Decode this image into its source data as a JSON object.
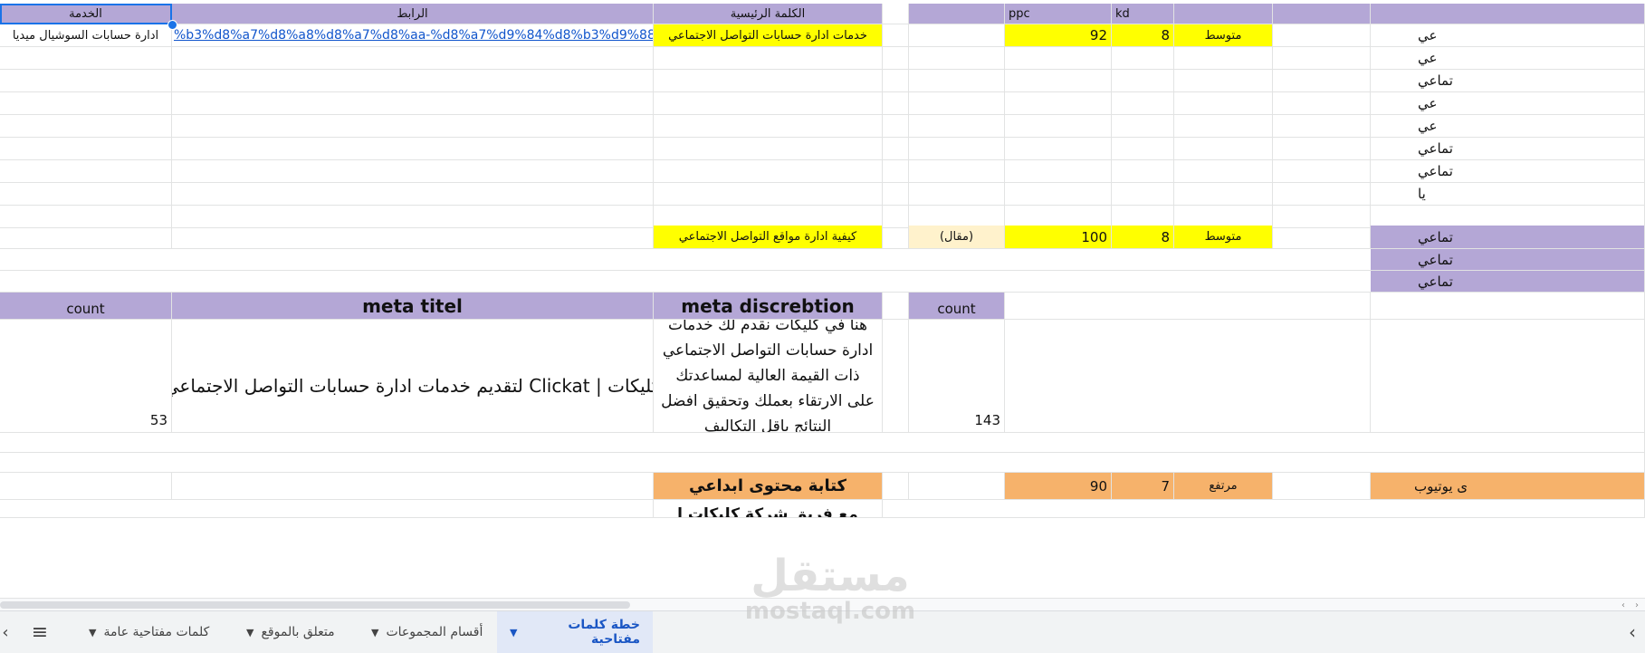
{
  "sheet": {
    "headers": {
      "service": "الخدمة",
      "link": "الرابط",
      "main_keyword": "الكلمة الرئيسية",
      "ppc": "ppc",
      "kd": "kd"
    },
    "row1": {
      "service": "ادارة حسابات السوشيال ميديا",
      "link": "%b3%d8%a7%d8%a8%d8%a7%d8%aa-%d8%a7%d9%84%d8%b3%d9%88%d8%",
      "keyword": "خدمات ادارة حسابات التواصل الاجتماعي",
      "ppc": "92",
      "kd": "8",
      "level": "متوسط"
    },
    "row2": {
      "keyword": "كيفية ادارة مواقع التواصل الاجتماعي",
      "type": "(مقال)",
      "ppc": "100",
      "kd": "8",
      "level": "متوسط"
    },
    "meta_headers": {
      "count_left": "count",
      "title": "meta titel",
      "description": "meta discrebtion",
      "count_right": "count"
    },
    "meta_row": {
      "count_left": "53",
      "title": "كليكات | Clickat  لتقديم خدمات ادارة حسابات التواصل الاجتماعي",
      "description": "هنا في كليكات  نقدم لك خدمات ادارة حسابات التواصل الاجتماعي  ذات القيمة العالية  لمساعدتك على الارتقاء بعملك  وتحقيق افضل النتائج باقل التكاليف",
      "count_right": "143"
    },
    "row3": {
      "keyword": "كتابة  محتوى ابداعي",
      "ppc": "90",
      "kd": "7",
      "level": "مرتفع"
    },
    "row3_partial": "مع فريق شركة كليكات ا",
    "edge_texts": [
      "عي",
      "عي",
      "تماعي",
      "عي",
      "عي",
      "تماعي",
      "تماعي",
      "يا",
      "تماعي",
      "تماعي",
      "تماعي",
      "ى يوتيوب"
    ]
  },
  "tabs": [
    {
      "label": "خطة كلمات مفتاحية",
      "active": true
    },
    {
      "label": "أقسام المجموعات",
      "active": false
    },
    {
      "label": "متعلق بالموقع",
      "active": false
    },
    {
      "label": "كلمات مفتاحية عامة",
      "active": false
    }
  ],
  "icons": {
    "all_sheets": "hamburger-menu-icon",
    "nav_left": "chevron-left-icon",
    "nav_right": "chevron-right-icon",
    "tab_caret": "caret-down-icon"
  },
  "colors": {
    "header_purple": "#b4a7d6",
    "yellow": "#ffff00",
    "orange": "#f6b26b",
    "cream": "#fff2cc",
    "link_blue": "#1155cc",
    "selection_blue": "#1a73e8"
  },
  "watermark": {
    "arabic": "مستقل",
    "latin": "mostaql.com"
  }
}
